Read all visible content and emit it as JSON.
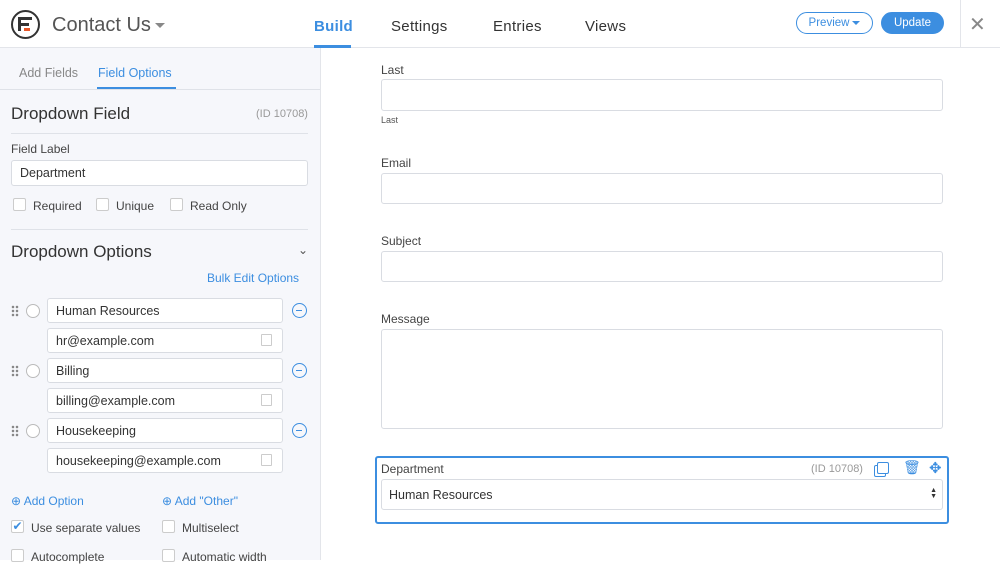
{
  "header": {
    "title": "Contact Us",
    "tabs": [
      "Build",
      "Settings",
      "Entries",
      "Views"
    ],
    "active_tab": "Build",
    "preview_label": "Preview",
    "update_label": "Update"
  },
  "sidebar": {
    "tabs": [
      "Add Fields",
      "Field Options"
    ],
    "field_title": "Dropdown Field",
    "field_id": "(ID 10708)",
    "field_label_heading": "Field Label",
    "field_label_value": "Department",
    "checks": [
      "Required",
      "Unique",
      "Read Only"
    ],
    "options_heading": "Dropdown Options",
    "bulk_edit": "Bulk Edit Options",
    "options": [
      {
        "label": "Human Resources",
        "value": "hr@example.com"
      },
      {
        "label": "Billing",
        "value": "billing@example.com"
      },
      {
        "label": "Housekeeping",
        "value": "housekeeping@example.com"
      }
    ],
    "add_option": "Add Option",
    "add_other": "Add \"Other\"",
    "bottom_checks": [
      {
        "label": "Use separate values",
        "checked": true
      },
      {
        "label": "Multiselect",
        "checked": false
      },
      {
        "label": "Autocomplete",
        "checked": false
      },
      {
        "label": "Automatic width",
        "checked": false
      }
    ]
  },
  "form": {
    "last_label": "Last",
    "last_sublabel": "Last",
    "email_label": "Email",
    "subject_label": "Subject",
    "message_label": "Message",
    "department": {
      "label": "Department",
      "id": "(ID 10708)",
      "selected": "Human Resources"
    }
  },
  "colors": {
    "accent": "#3c8ee0"
  }
}
